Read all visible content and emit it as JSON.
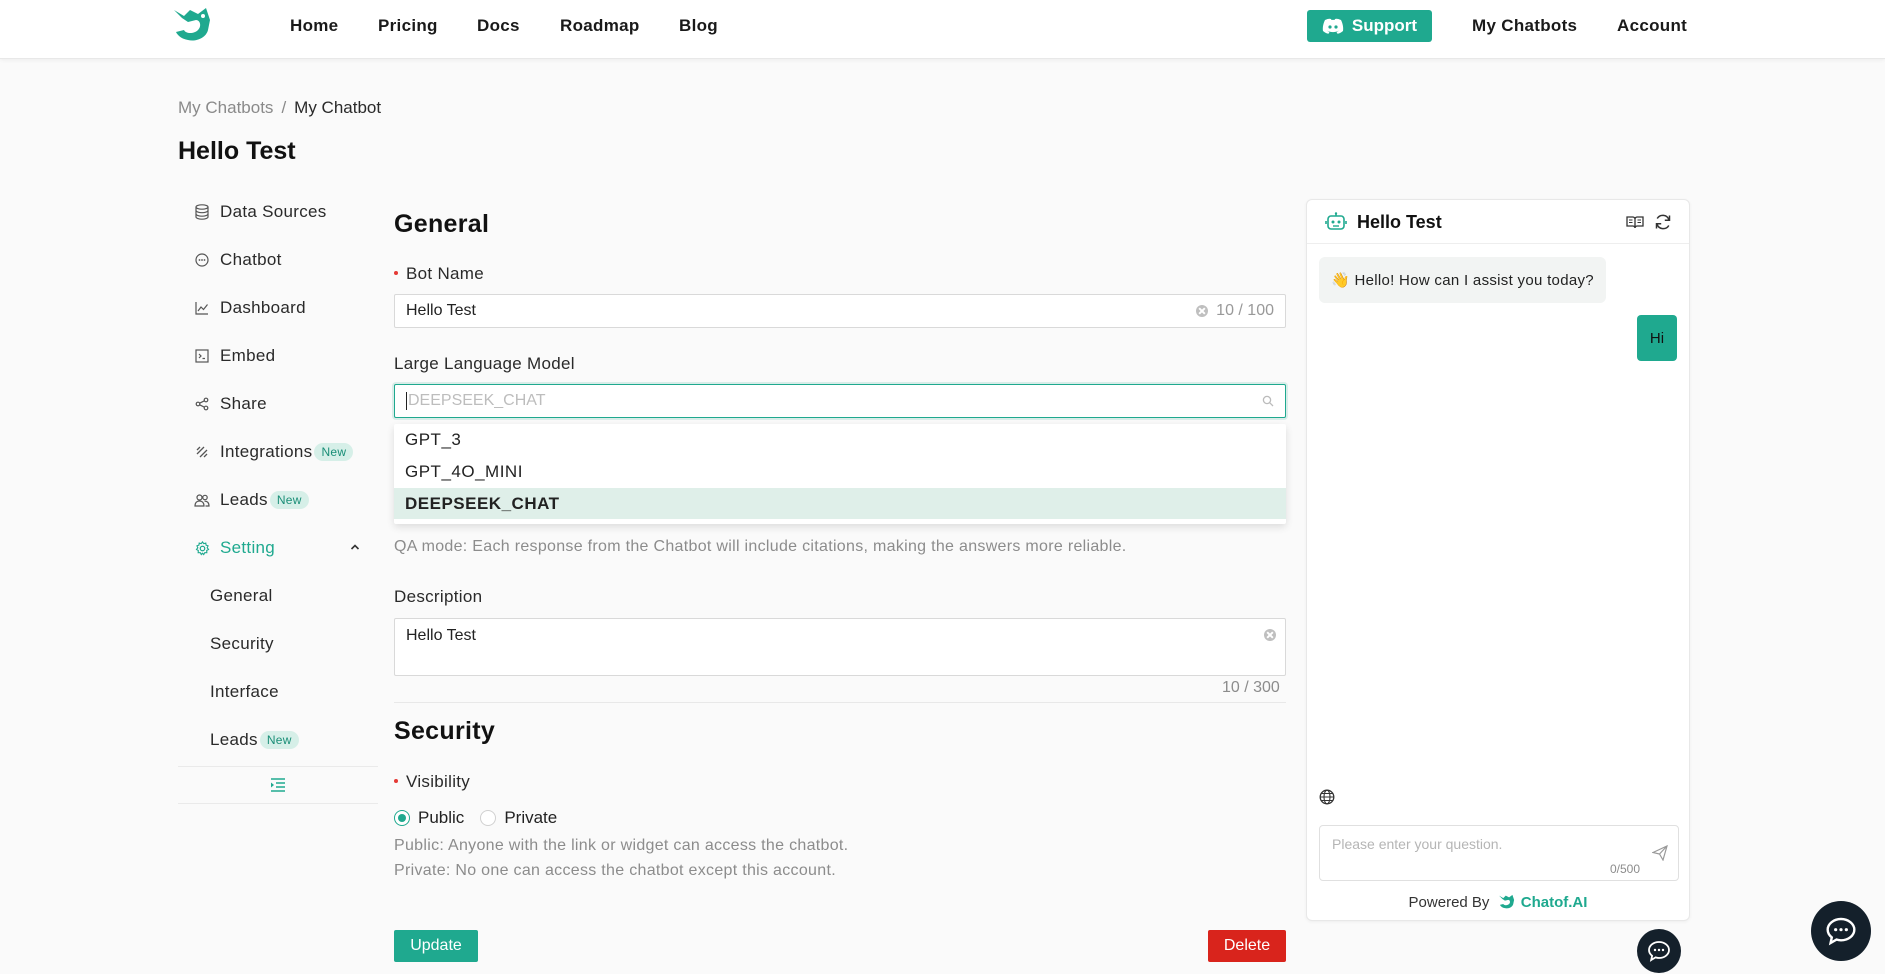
{
  "nav": {
    "links": [
      "Home",
      "Pricing",
      "Docs",
      "Roadmap",
      "Blog"
    ],
    "support_label": "Support",
    "my_chatbots": "My Chatbots",
    "account": "Account"
  },
  "breadcrumb": {
    "parent": "My Chatbots",
    "separator": "/",
    "current": "My Chatbot"
  },
  "page_title": "Hello Test",
  "sidebar": {
    "items": [
      {
        "label": "Data Sources",
        "icon": "database-icon"
      },
      {
        "label": "Chatbot",
        "icon": "chat-icon"
      },
      {
        "label": "Dashboard",
        "icon": "line-chart-icon"
      },
      {
        "label": "Embed",
        "icon": "code-icon"
      },
      {
        "label": "Share",
        "icon": "share-icon"
      },
      {
        "label": "Integrations",
        "icon": "integrations-icon",
        "badge": "New"
      },
      {
        "label": "Leads",
        "icon": "team-icon",
        "badge": "New"
      },
      {
        "label": "Setting",
        "icon": "gear-icon",
        "active": true
      }
    ],
    "sub_items": [
      {
        "label": "General"
      },
      {
        "label": "Security"
      },
      {
        "label": "Interface"
      },
      {
        "label": "Leads",
        "badge": "New"
      }
    ]
  },
  "general": {
    "title": "General",
    "bot_name_label": "Bot Name",
    "bot_name_value": "Hello Test",
    "bot_name_count": "10 / 100",
    "llm_label": "Large Language Model",
    "llm_placeholder": "DEEPSEEK_CHAT",
    "llm_options": [
      "GPT_3",
      "GPT_4O_MINI",
      "DEEPSEEK_CHAT"
    ],
    "llm_selected": "DEEPSEEK_CHAT",
    "qa_help": "QA mode: Each response from the Chatbot will include citations, making the answers more reliable.",
    "description_label": "Description",
    "description_value": "Hello Test",
    "description_count": "10 / 300"
  },
  "security": {
    "title": "Security",
    "visibility_label": "Visibility",
    "options": [
      "Public",
      "Private"
    ],
    "selected": "Public",
    "help_public": "Public: Anyone with the link or widget can access the chatbot.",
    "help_private": "Private: No one can access the chatbot except this account."
  },
  "actions": {
    "update": "Update",
    "delete": "Delete"
  },
  "chat": {
    "title": "Hello Test",
    "bot_greeting": "👋 Hello! How can I assist you today?",
    "user_message": "Hi",
    "input_placeholder": "Please enter your question.",
    "input_count": "0/500",
    "powered_by": "Powered By",
    "brand": "Chatof.AI"
  },
  "colors": {
    "accent": "#1fa98f",
    "danger": "#d9241c",
    "fab": "#14202b"
  }
}
